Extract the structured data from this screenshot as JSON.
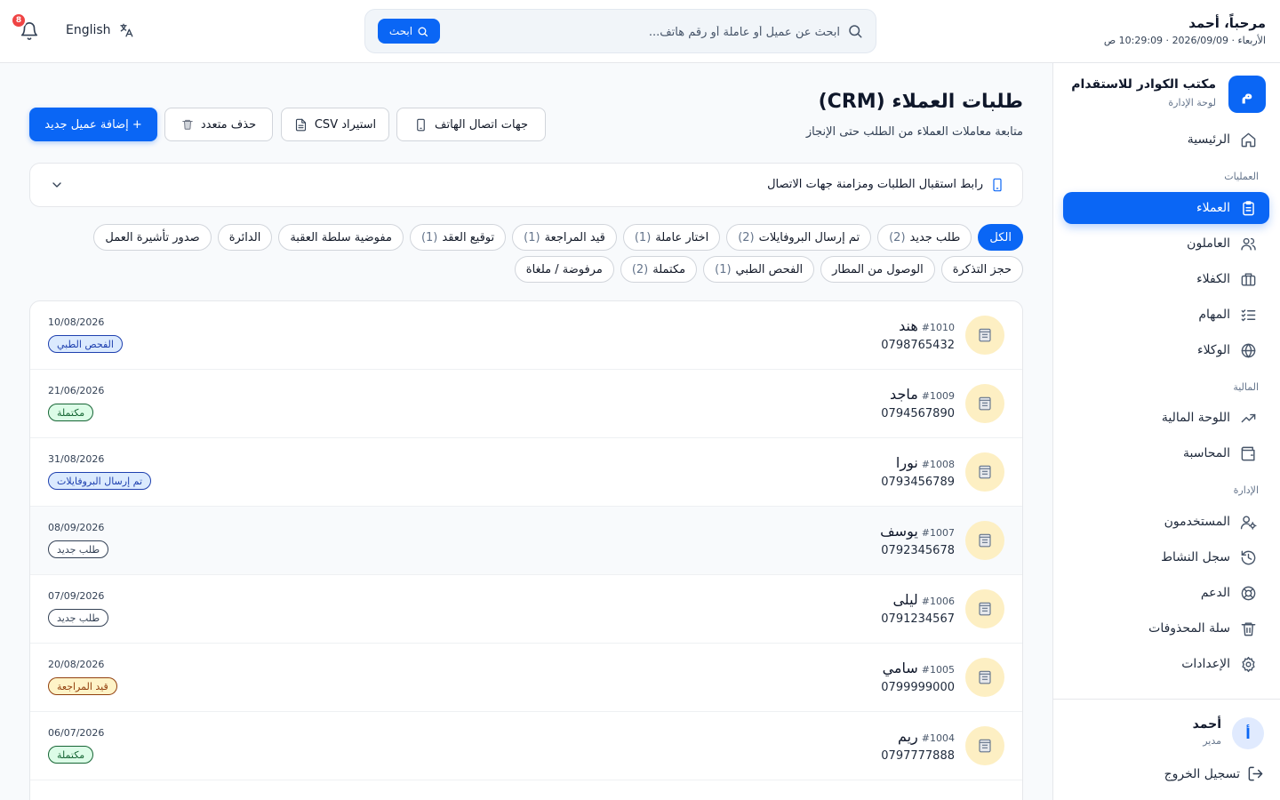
{
  "header": {
    "greeting": "مرحباً، أحمد",
    "datetime": "الأربعاء · 2026/09/09 · 10:29:09 ص",
    "search_placeholder": "ابحث عن عميل أو عاملة أو رقم هاتف...",
    "search_button": "ابحث",
    "language": "English",
    "notification_count": "8"
  },
  "sidebar": {
    "brand_initial": "م",
    "brand_name": "مكتب الكوادر للاستقدام",
    "brand_sub": "لوحة الإدارة",
    "home": "الرئيسية",
    "sections": {
      "operations": "العمليات",
      "finance": "المالية",
      "admin": "الإدارة"
    },
    "items": {
      "clients": "العملاء",
      "workers": "العاملون",
      "sponsors": "الكفلاء",
      "tasks": "المهام",
      "agents": "الوكلاء",
      "finance_board": "اللوحة المالية",
      "accounting": "المحاسبة",
      "users": "المستخدمون",
      "activity_log": "سجل النشاط",
      "support": "الدعم",
      "trash": "سلة المحذوفات",
      "settings": "الإعدادات"
    },
    "user": {
      "initial": "أ",
      "name": "أحمد",
      "role": "مدير"
    },
    "logout": "تسجيل الخروج"
  },
  "main": {
    "title": "طلبات العملاء (CRM)",
    "subtitle": "متابعة معاملات العملاء من الطلب حتى الإنجاز",
    "buttons": {
      "add_client": "+ إضافة عميل جديد",
      "bulk_delete": "حذف متعدد",
      "import_csv": "استيراد CSV",
      "phone_contacts": "جهات اتصال الهاتف"
    },
    "info_bar": "رابط استقبال الطلبات ومزامنة جهات الاتصال",
    "filters": [
      {
        "label": "الكل",
        "count": ""
      },
      {
        "label": "طلب جديد",
        "count": "(2)"
      },
      {
        "label": "تم إرسال البروفايلات",
        "count": "(2)"
      },
      {
        "label": "اختار عاملة",
        "count": "(1)"
      },
      {
        "label": "قيد المراجعة",
        "count": "(1)"
      },
      {
        "label": "توقيع العقد",
        "count": "(1)"
      },
      {
        "label": "مفوضية سلطة العقبة",
        "count": ""
      },
      {
        "label": "الدائرة",
        "count": ""
      },
      {
        "label": "صدور تأشيرة العمل",
        "count": ""
      },
      {
        "label": "حجز التذكرة",
        "count": ""
      },
      {
        "label": "الوصول من المطار",
        "count": ""
      },
      {
        "label": "الفحص الطبي",
        "count": "(1)"
      },
      {
        "label": "مكتملة",
        "count": "(2)"
      },
      {
        "label": "مرفوضة / ملغاة",
        "count": ""
      }
    ],
    "clients": [
      {
        "id": "#1010",
        "name": "هند",
        "phone": "0798765432",
        "date": "10/08/2026",
        "status": "الفحص الطبي",
        "tone": "blue"
      },
      {
        "id": "#1009",
        "name": "ماجد",
        "phone": "0794567890",
        "date": "21/06/2026",
        "status": "مكتملة",
        "tone": "green"
      },
      {
        "id": "#1008",
        "name": "نورا",
        "phone": "0793456789",
        "date": "31/08/2026",
        "status": "تم إرسال البروفايلات",
        "tone": "blue"
      },
      {
        "id": "#1007",
        "name": "يوسف",
        "phone": "0792345678",
        "date": "08/09/2026",
        "status": "طلب جديد",
        "tone": "gray"
      },
      {
        "id": "#1006",
        "name": "ليلى",
        "phone": "0791234567",
        "date": "07/09/2026",
        "status": "طلب جديد",
        "tone": "gray"
      },
      {
        "id": "#1005",
        "name": "سامي",
        "phone": "0799999000",
        "date": "20/08/2026",
        "status": "قيد المراجعة",
        "tone": "yellow"
      },
      {
        "id": "#1004",
        "name": "ريم",
        "phone": "0797777888",
        "date": "06/07/2026",
        "status": "مكتملة",
        "tone": "green"
      }
    ]
  }
}
